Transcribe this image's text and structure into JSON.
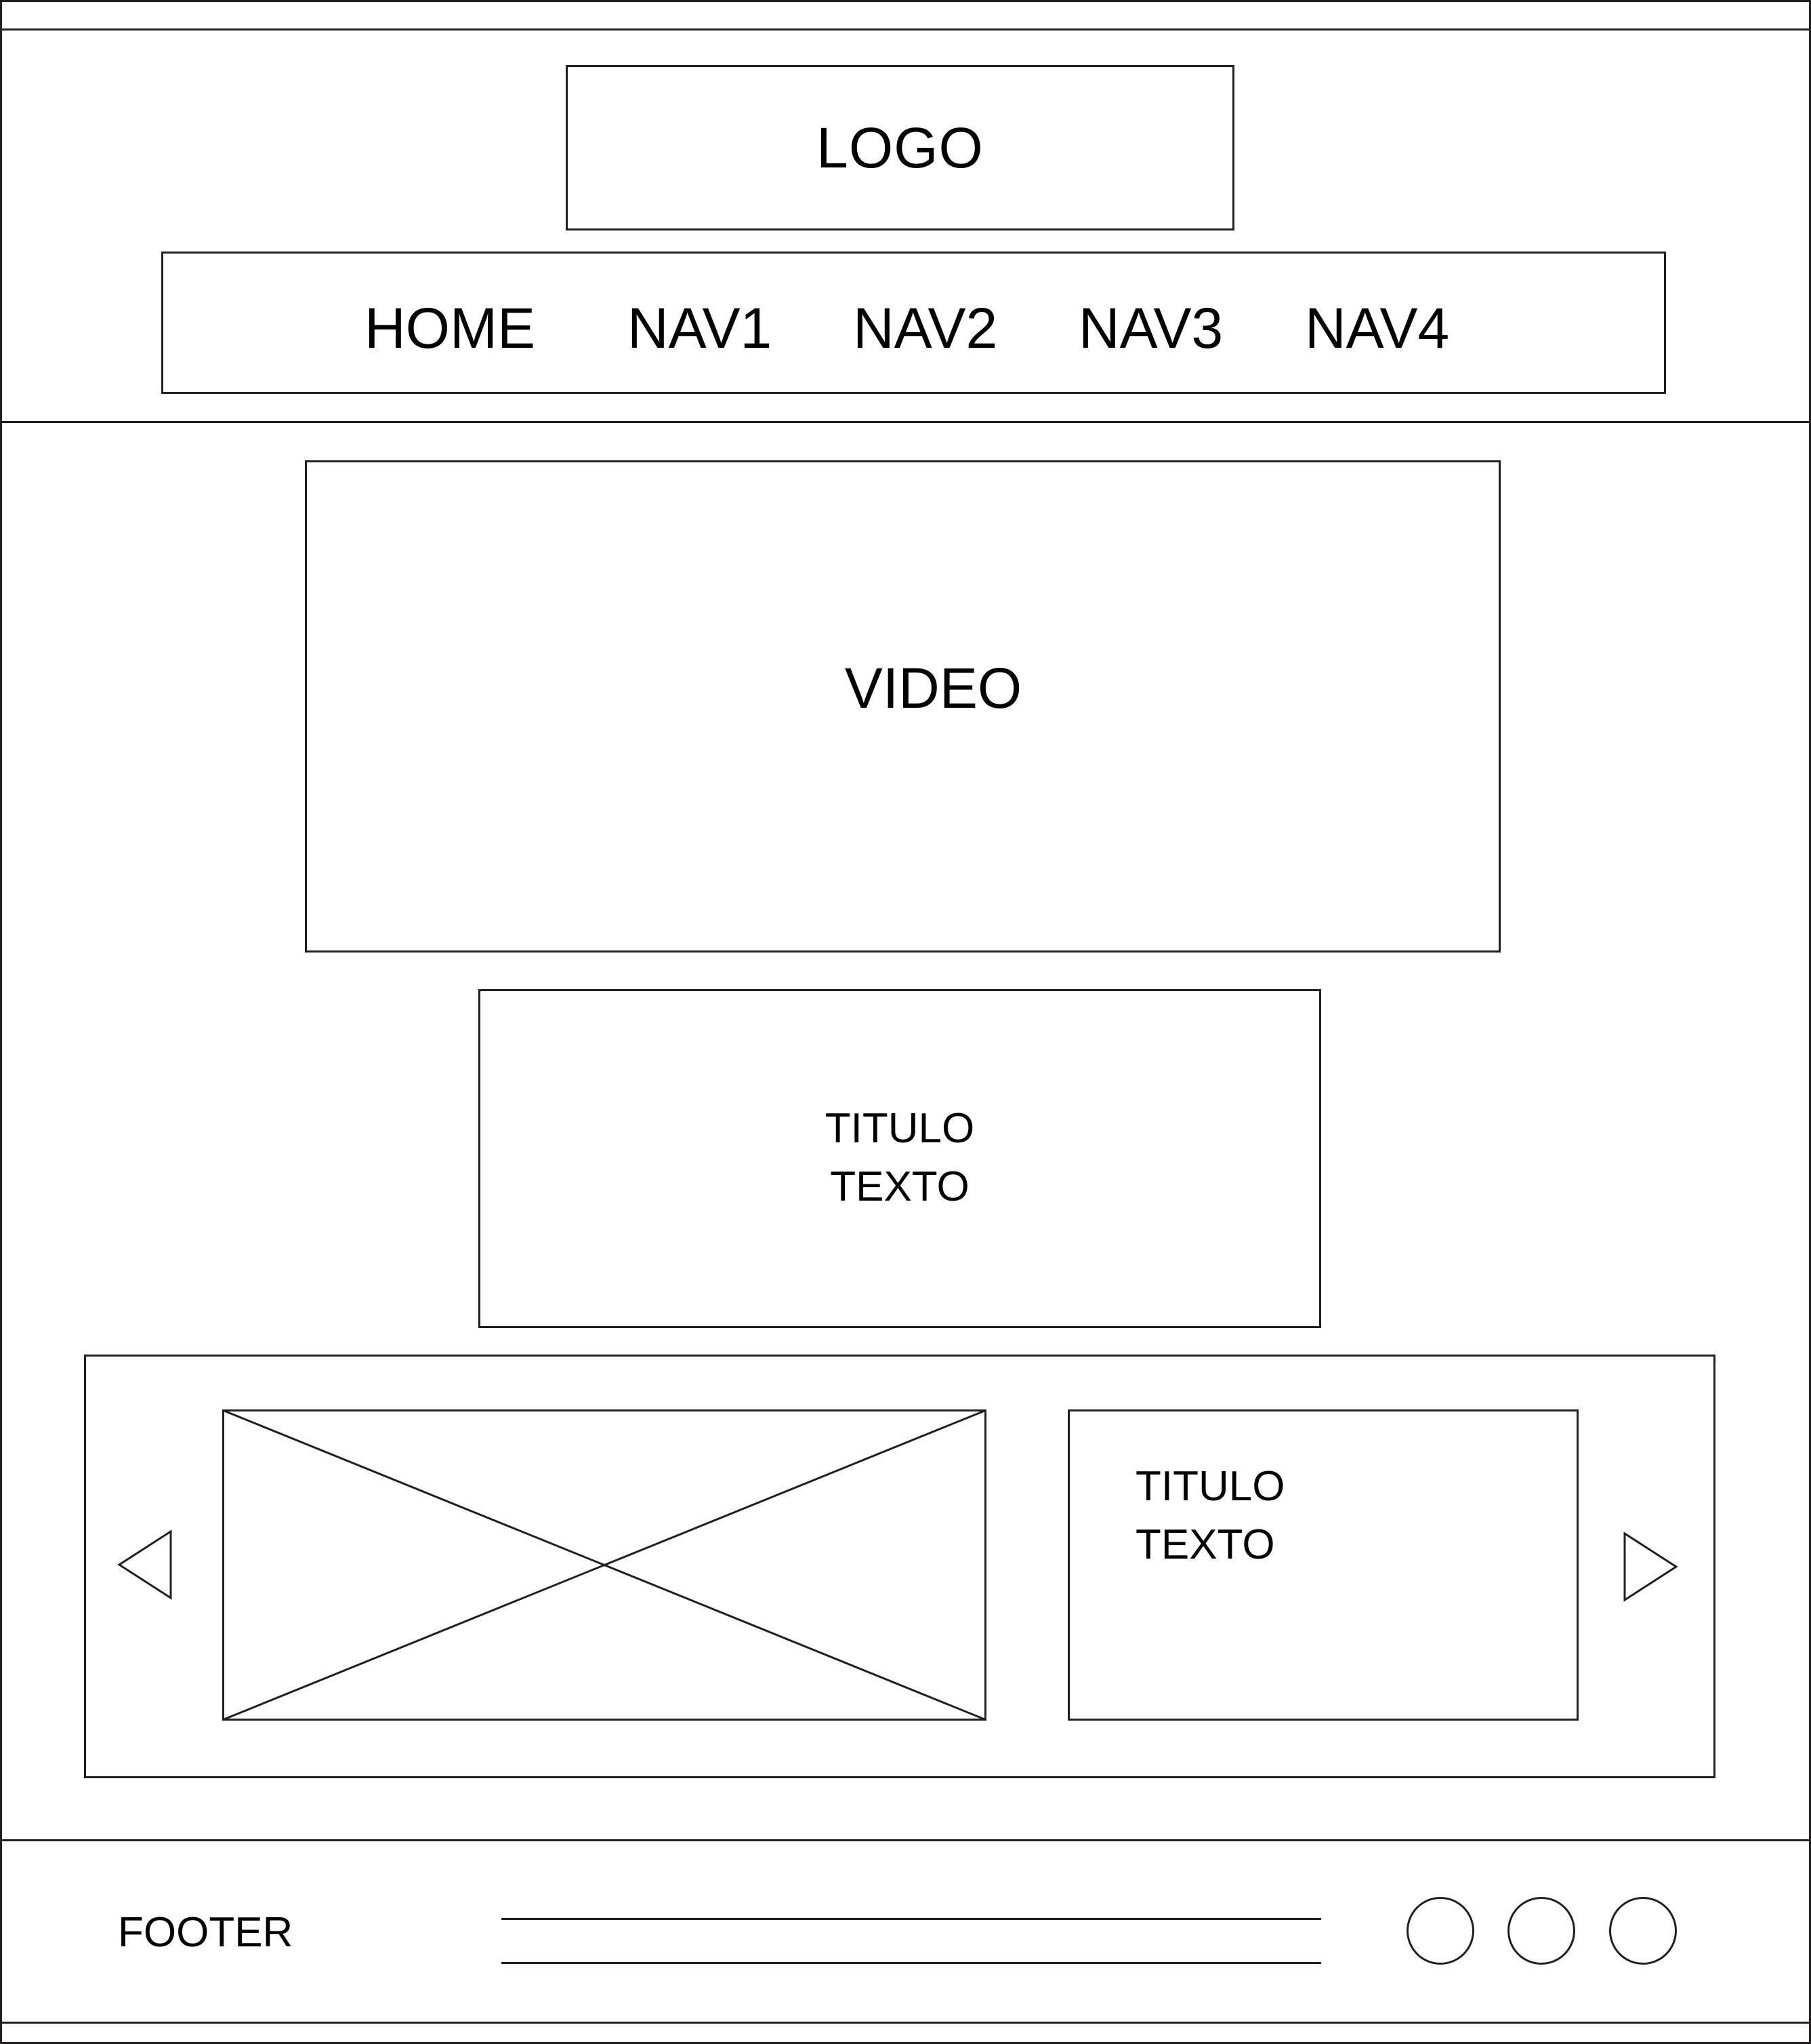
{
  "header": {
    "logo": "LOGO",
    "nav": [
      "HOME",
      "NAV1",
      "NAV2",
      "NAV3",
      "NAV4"
    ]
  },
  "hero": {
    "video_label": "VIDEO"
  },
  "intro": {
    "title": "TITULO",
    "text": "TEXTO"
  },
  "carousel": {
    "prev_icon": "triangle-left-icon",
    "next_icon": "triangle-right-icon",
    "image_placeholder": "image-placeholder-x",
    "slide": {
      "title": "TITULO",
      "text": "TEXTO"
    }
  },
  "footer": {
    "label": "FOOTER",
    "social_icons": [
      "circle-icon",
      "circle-icon",
      "circle-icon"
    ]
  },
  "colors": {
    "stroke": "#231f20",
    "background": "#ffffff"
  }
}
